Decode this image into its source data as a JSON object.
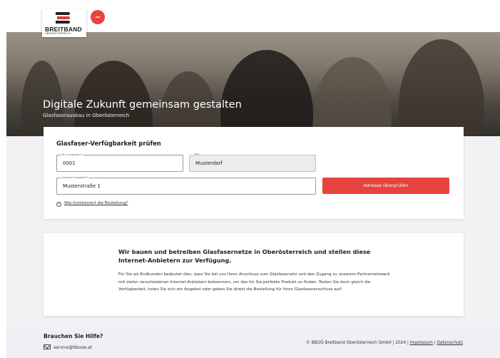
{
  "logo": {
    "name": "BREITBAND",
    "sub": "OBERÖSTERREICH",
    "badge_text": "ooo"
  },
  "hero": {
    "title": "Digitale Zukunft gemeinsam gestalten",
    "subtitle": "Glasfaserausbau in Oberösterreich"
  },
  "check_form": {
    "title": "Glasfaser-Verfügbarkeit prüfen",
    "plz": {
      "label": "PLZ eingeben*",
      "value": "0001"
    },
    "ort": {
      "label": "Ort",
      "value": "Musterdorf"
    },
    "adresse": {
      "label": "Adresse eingeben*",
      "value": "Musterstraße 1"
    },
    "submit_label": "Adresse überprüfen",
    "howto_link": "Wie funktioniert die Bestellung?"
  },
  "info": {
    "title": "Wir bauen und betreiben Glasfasernetze in Oberösterreich und stellen diese Internet-Anbietern zur Verfügung.",
    "body": "Für Sie als Endkunden bedeutet dies, dass Sie bei uns Ihren Anschluss zum Glasfasernetz und den Zugang zu unserem Partnernetzwerk mit vielen verschiedenen Internet-Anbietern bekommen, um das für Sie perfekte Produkt zu finden. Testen Sie doch gleich die Verfügbarkeit, holen Sie sich ein Angebot oder geben Sie direkt die Bestellung für Ihren Glasfaseranschluss auf!"
  },
  "footer": {
    "help_title": "Brauchen Sie Hilfe?",
    "email": "service@bbooe.at",
    "copyright": "© BBOÖ Breitband Oberösterreich GmbH | 2024 |",
    "impressum": "Impressum",
    "separator": "|",
    "datenschutz": "Datenschutz"
  },
  "colors": {
    "accent": "#e5443f",
    "footer_bg": "#eef0f4"
  }
}
